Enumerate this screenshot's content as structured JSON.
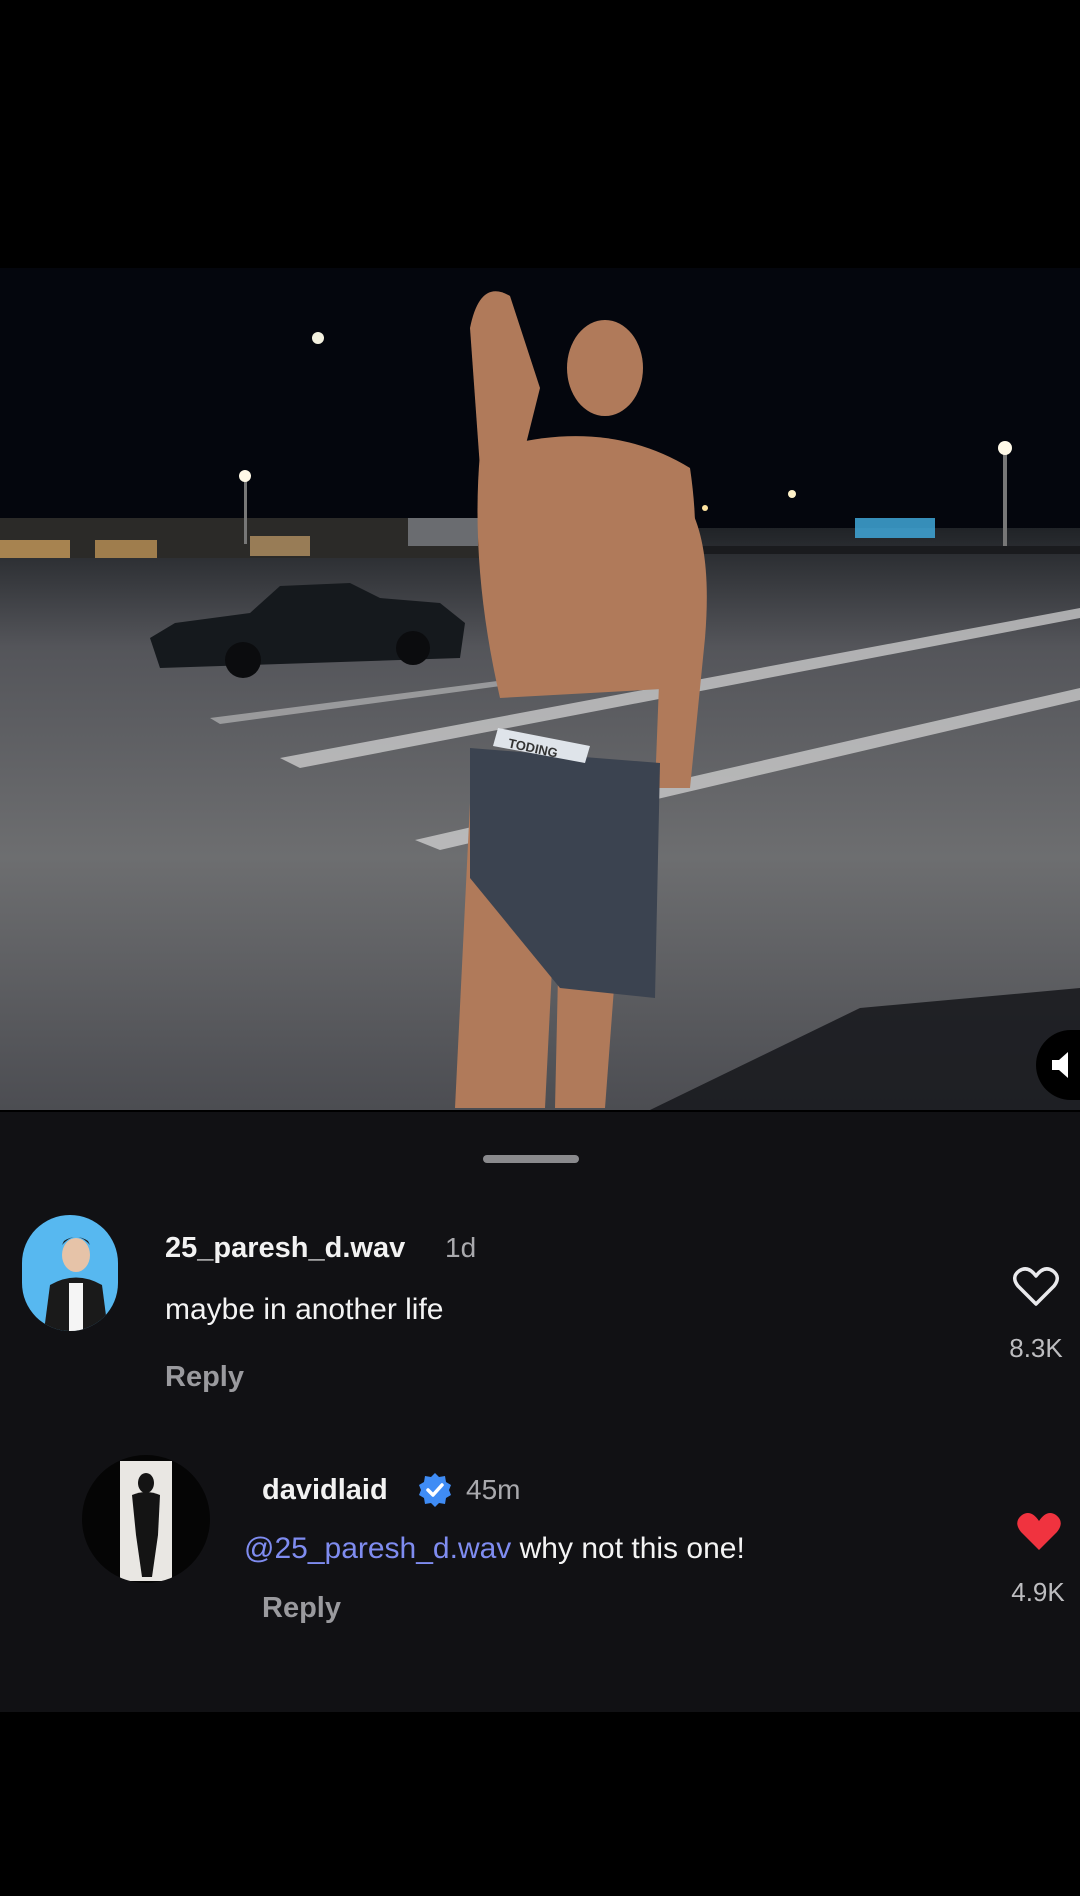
{
  "colors": {
    "sheet_bg": "#111114",
    "mention": "#7f8cf0",
    "liked_heart": "#f0333f",
    "verified_badge": "#3f8cf5"
  },
  "video": {
    "waistband_text": "TODING",
    "mute_icon": "speaker-icon"
  },
  "comments": [
    {
      "username": "25_paresh_d.wav",
      "time": "1d",
      "text": "maybe in another life",
      "reply_label": "Reply",
      "like_count": "8.3K",
      "liked": false
    },
    {
      "username": "davidlaid",
      "verified": true,
      "time": "45m",
      "mention": "@25_paresh_d.wav",
      "text": "why not this one!",
      "reply_label": "Reply",
      "like_count": "4.9K",
      "liked": true
    }
  ]
}
